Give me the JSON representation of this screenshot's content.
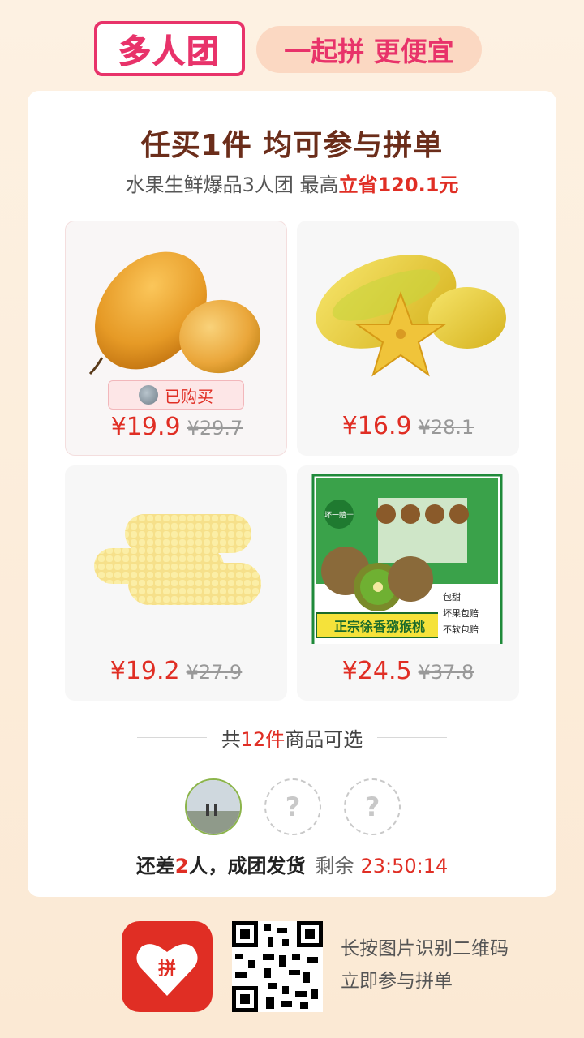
{
  "header": {
    "brand": "多人团",
    "slogan": "一起拼 更便宜"
  },
  "card": {
    "title": "任买1件 均可参与拼单",
    "subtitle_prefix": "水果生鲜爆品3人团 最高",
    "subtitle_highlight": "立省120.1元",
    "products": [
      {
        "name": "mango",
        "price": "¥19.9",
        "original_price": "¥29.7",
        "badge": "已购买"
      },
      {
        "name": "starfruit",
        "price": "¥16.9",
        "original_price": "¥28.1"
      },
      {
        "name": "corn",
        "price": "¥19.2",
        "original_price": "¥27.9"
      },
      {
        "name": "kiwi",
        "price": "¥24.5",
        "original_price": "¥37.8",
        "box_banner": "正宗徐香猕猴桃",
        "box_tag": "坏一赔十",
        "features": [
          "包甜",
          "坏果包赔",
          "不软包赔"
        ]
      }
    ],
    "total_prefix": "共",
    "total_count": "12件",
    "total_suffix": "商品可选",
    "placeholder_mark": "?",
    "status_prefix": "还差",
    "status_count": "2",
    "status_suffix": "人，成团发货",
    "remain_label": "剩余",
    "countdown": "23:50:14"
  },
  "footer": {
    "line1": "长按图片识别二维码",
    "line2": "立即参与拼单",
    "app_icon_text": "拼"
  },
  "colors": {
    "accent": "#e02e24",
    "brand_pink": "#e8336a",
    "title_brown": "#6b2d1a"
  }
}
